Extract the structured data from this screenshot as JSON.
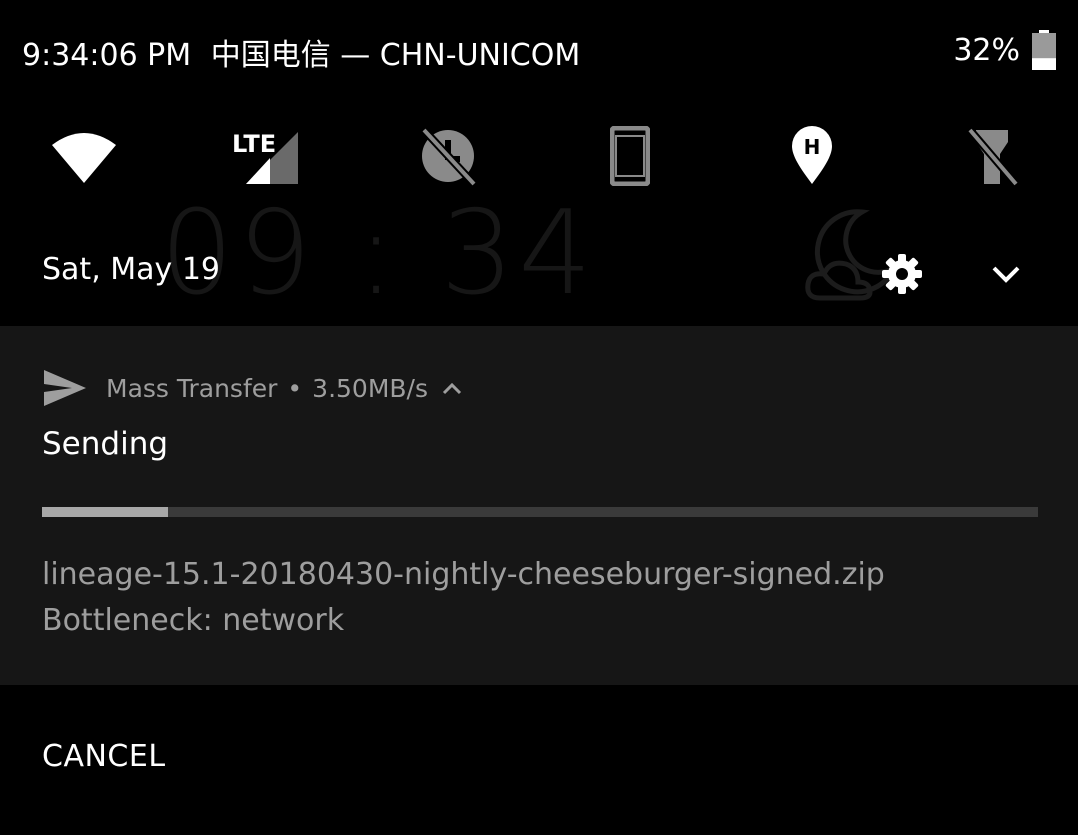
{
  "status_bar": {
    "time": "9:34:06 PM",
    "carrier": "中国电信 — CHN-UNICOM",
    "battery_percent": "32%",
    "battery_level": 0.32
  },
  "quick_settings": {
    "tiles": [
      {
        "icon": "wifi-icon",
        "state": "on"
      },
      {
        "icon": "lte-signal-icon",
        "label": "LTE",
        "state": "on"
      },
      {
        "icon": "do-not-disturb-off-icon",
        "state": "off"
      },
      {
        "icon": "auto-rotate-portrait-icon",
        "state": "off"
      },
      {
        "icon": "location-icon",
        "state": "on"
      },
      {
        "icon": "flashlight-off-icon",
        "state": "off"
      }
    ]
  },
  "header": {
    "date": "Sat, May 19"
  },
  "background": {
    "clock": "09 : 34"
  },
  "notification": {
    "app_name": "Mass Transfer",
    "separator": "•",
    "speed": "3.50MB/s",
    "title": "Sending",
    "progress": 0.127,
    "filename": "lineage-15.1-20180430-nightly-cheeseburger-signed.zip",
    "status": "Bottleneck: network"
  },
  "actions": {
    "cancel_label": "CANCEL"
  },
  "colors": {
    "notification_bg": "#161616",
    "progress_track": "#3a3a3a",
    "progress_fill": "#a8a8a8",
    "secondary_text": "#9e9e9e"
  }
}
